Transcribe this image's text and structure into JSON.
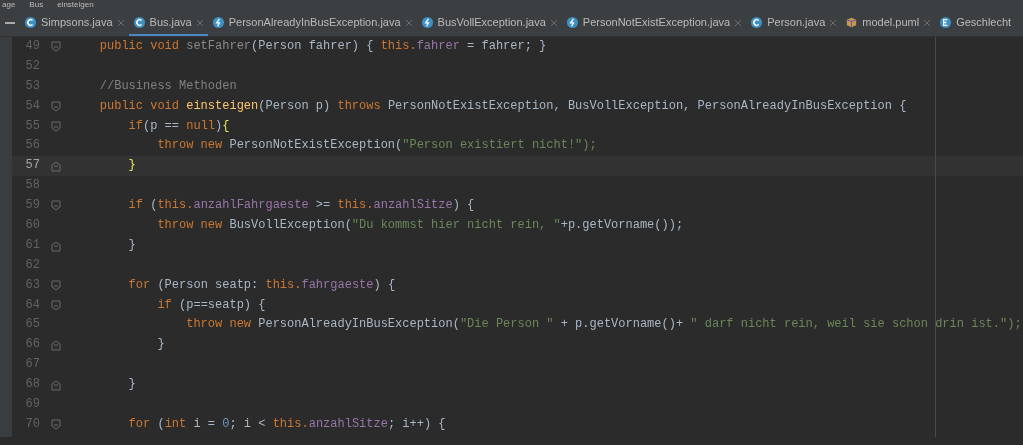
{
  "breadcrumb": [
    "age",
    "Bus",
    "einsteigen"
  ],
  "tabs": [
    {
      "label": "Simpsons.java",
      "kind": "class",
      "selected": false
    },
    {
      "label": "Bus.java",
      "kind": "class",
      "selected": true
    },
    {
      "label": "PersonAlreadyInBusException.java",
      "kind": "exception",
      "selected": false
    },
    {
      "label": "BusVollException.java",
      "kind": "exception",
      "selected": false
    },
    {
      "label": "PersonNotExistException.java",
      "kind": "exception",
      "selected": false
    },
    {
      "label": "Person.java",
      "kind": "class",
      "selected": false
    },
    {
      "label": "model.puml",
      "kind": "puml",
      "selected": false
    },
    {
      "label": "Geschlecht",
      "kind": "enum",
      "selected": false
    }
  ],
  "lines": [
    {
      "number": "49",
      "kind": "fold-start",
      "current": false,
      "tokens": [
        {
          "color": "#cc7832",
          "t": "    public void "
        },
        {
          "color": "#8a8a8a",
          "t": "setFahrer"
        },
        {
          "color": "#a9b7c6",
          "t": "(Person fahrer) { "
        },
        {
          "color": "#cc7832",
          "t": "this."
        },
        {
          "color": "#9876aa",
          "t": "fahrer"
        },
        {
          "color": "#a9b7c6",
          "t": " = fahrer; }"
        }
      ]
    },
    {
      "number": "52",
      "kind": "plain",
      "current": false
    },
    {
      "number": "53",
      "kind": "plain",
      "current": false,
      "tokens": [
        {
          "color": "#808080",
          "t": "    //Business Methoden"
        }
      ]
    },
    {
      "number": "54",
      "kind": "fold-start",
      "current": false,
      "tokens": [
        {
          "color": "#cc7832",
          "t": "    public void "
        },
        {
          "color": "#ffc66d",
          "t": "einsteigen"
        },
        {
          "color": "#a9b7c6",
          "t": "(Person p) "
        },
        {
          "color": "#cc7832",
          "t": "throws "
        },
        {
          "color": "#a9b7c6",
          "t": "PersonNotExistException, BusVollException, PersonAlreadyInBusException {"
        }
      ]
    },
    {
      "number": "55",
      "kind": "fold-start",
      "current": false,
      "tokens": [
        {
          "color": "#cc7832",
          "t": "        if"
        },
        {
          "color": "#a9b7c6",
          "t": "(p == "
        },
        {
          "color": "#cc7832",
          "t": "null"
        },
        {
          "color": "#a9b7c6",
          "t": ")"
        },
        {
          "color": "#e8e85a",
          "t": "{"
        }
      ]
    },
    {
      "number": "56",
      "kind": "plain",
      "current": false,
      "tokens": [
        {
          "color": "#cc7832",
          "t": "            throw new "
        },
        {
          "color": "#a9b7c6",
          "t": "PersonNotExistException("
        },
        {
          "color": "#6a8759",
          "t": "\"Person existiert nicht!\");"
        }
      ]
    },
    {
      "number": "57",
      "kind": "fold-end",
      "current": true,
      "tokens": [
        {
          "color": "#e8e85a",
          "t": "        }"
        }
      ]
    },
    {
      "number": "58",
      "kind": "plain",
      "current": false
    },
    {
      "number": "59",
      "kind": "fold-start",
      "current": false,
      "tokens": [
        {
          "color": "#cc7832",
          "t": "        if "
        },
        {
          "color": "#a9b7c6",
          "t": "("
        },
        {
          "color": "#cc7832",
          "t": "this."
        },
        {
          "color": "#9876aa",
          "t": "anzahlFahrgaeste"
        },
        {
          "color": "#a9b7c6",
          "t": " >= "
        },
        {
          "color": "#cc7832",
          "t": "this."
        },
        {
          "color": "#9876aa",
          "t": "anzahlSitze"
        },
        {
          "color": "#a9b7c6",
          "t": ") {"
        }
      ]
    },
    {
      "number": "60",
      "kind": "plain",
      "current": false,
      "tokens": [
        {
          "color": "#cc7832",
          "t": "            throw new "
        },
        {
          "color": "#a9b7c6",
          "t": "BusVollException("
        },
        {
          "color": "#6a8759",
          "t": "\"Du kommst hier nicht rein, \""
        },
        {
          "color": "#a9b7c6",
          "t": "+p.getVorname());"
        }
      ]
    },
    {
      "number": "61",
      "kind": "fold-end",
      "current": false,
      "tokens": [
        {
          "color": "#a9b7c6",
          "t": "        }"
        }
      ]
    },
    {
      "number": "62",
      "kind": "plain",
      "current": false
    },
    {
      "number": "63",
      "kind": "fold-start",
      "current": false,
      "tokens": [
        {
          "color": "#cc7832",
          "t": "        for "
        },
        {
          "color": "#a9b7c6",
          "t": "(Person seatp: "
        },
        {
          "color": "#cc7832",
          "t": "this."
        },
        {
          "color": "#9876aa",
          "t": "fahrgaeste"
        },
        {
          "color": "#a9b7c6",
          "t": ") {"
        }
      ]
    },
    {
      "number": "64",
      "kind": "fold-start",
      "current": false,
      "tokens": [
        {
          "color": "#cc7832",
          "t": "            if "
        },
        {
          "color": "#a9b7c6",
          "t": "(p==seatp) {"
        }
      ]
    },
    {
      "number": "65",
      "kind": "plain",
      "current": false,
      "tokens": [
        {
          "color": "#cc7832",
          "t": "                throw new "
        },
        {
          "color": "#a9b7c6",
          "t": "PersonAlreadyInBusException("
        },
        {
          "color": "#6a8759",
          "t": "\"Die Person \""
        },
        {
          "color": "#a9b7c6",
          "t": " + p.getVorname()+ "
        },
        {
          "color": "#6a8759",
          "t": "\" darf nicht rein, weil sie schon drin ist.\");"
        }
      ]
    },
    {
      "number": "66",
      "kind": "fold-end",
      "current": false,
      "tokens": [
        {
          "color": "#a9b7c6",
          "t": "            }"
        }
      ]
    },
    {
      "number": "67",
      "kind": "plain",
      "current": false
    },
    {
      "number": "68",
      "kind": "fold-end",
      "current": false,
      "tokens": [
        {
          "color": "#a9b7c6",
          "t": "        }"
        }
      ]
    },
    {
      "number": "69",
      "kind": "plain",
      "current": false
    },
    {
      "number": "70",
      "kind": "fold-start",
      "current": false,
      "tokens": [
        {
          "color": "#cc7832",
          "t": "        for "
        },
        {
          "color": "#a9b7c6",
          "t": "("
        },
        {
          "color": "#cc7832",
          "t": "int "
        },
        {
          "color": "#a9b7c6",
          "t": "i = "
        },
        {
          "color": "#6897bb",
          "t": "0"
        },
        {
          "color": "#a9b7c6",
          "t": "; i < "
        },
        {
          "color": "#cc7832",
          "t": "this."
        },
        {
          "color": "#9876aa",
          "t": "anzahlSitze"
        },
        {
          "color": "#a9b7c6",
          "t": "; i++) {"
        }
      ]
    }
  ]
}
